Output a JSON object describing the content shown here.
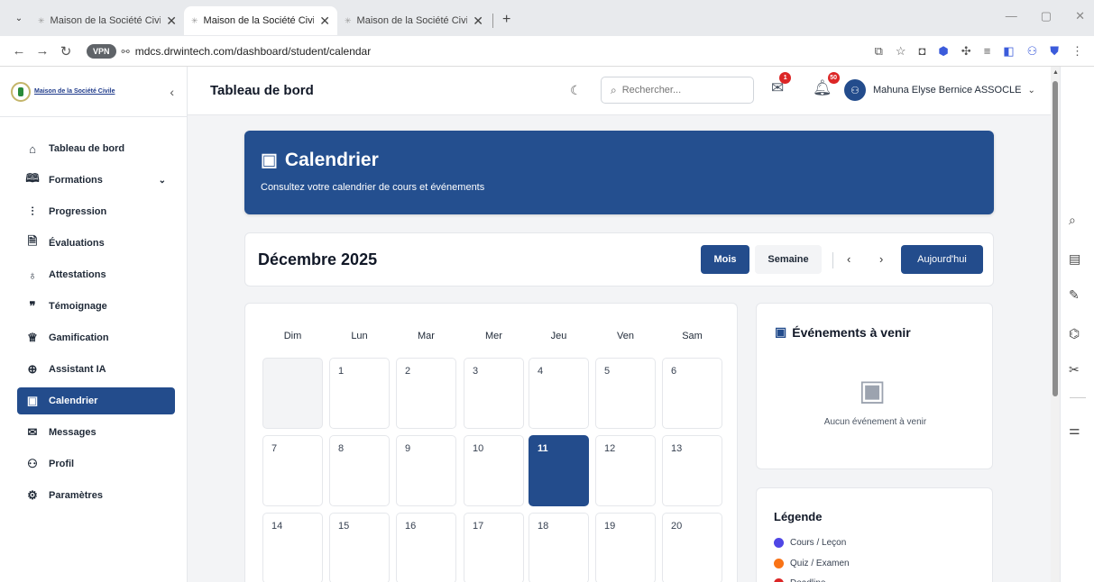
{
  "browser": {
    "tabs": [
      {
        "title": "Maison de la Société Civile - Pla",
        "active": false
      },
      {
        "title": "Maison de la Société Civile - Pla",
        "active": true
      },
      {
        "title": "Maison de la Société Civile - Pla",
        "active": false
      }
    ],
    "vpn_label": "VPN",
    "url": "mdcs.drwintech.com/dashboard/student/calendar"
  },
  "sidebar": {
    "logo_text": "Maison de la Société Civile",
    "items": [
      {
        "label": "Tableau de bord",
        "icon": "home-icon",
        "glyph": "⌂",
        "active": false
      },
      {
        "label": "Formations",
        "icon": "book-icon",
        "glyph": "🕮",
        "active": false,
        "has_chevron": true
      },
      {
        "label": "Progression",
        "icon": "bar-chart-icon",
        "glyph": "⫶",
        "active": false
      },
      {
        "label": "Évaluations",
        "icon": "document-icon",
        "glyph": "🗎",
        "active": false
      },
      {
        "label": "Attestations",
        "icon": "award-icon",
        "glyph": "♁",
        "active": false
      },
      {
        "label": "Témoignage",
        "icon": "quote-icon",
        "glyph": "❞",
        "active": false
      },
      {
        "label": "Gamification",
        "icon": "trophy-icon",
        "glyph": "♕",
        "active": false
      },
      {
        "label": "Assistant IA",
        "icon": "brain-icon",
        "glyph": "⊕",
        "active": false
      },
      {
        "label": "Calendrier",
        "icon": "calendar-icon",
        "glyph": "▣",
        "active": true
      },
      {
        "label": "Messages",
        "icon": "mail-icon",
        "glyph": "✉",
        "active": false
      },
      {
        "label": "Profil",
        "icon": "user-icon",
        "glyph": "⚇",
        "active": false
      },
      {
        "label": "Paramètres",
        "icon": "gear-icon",
        "glyph": "⚙",
        "active": false
      }
    ]
  },
  "header": {
    "title": "Tableau de bord",
    "search_placeholder": "Rechercher...",
    "messages_badge": "1",
    "notifications_badge": "50",
    "user_name": "Mahuna Elyse Bernice ASSOCLE"
  },
  "hero": {
    "title": "Calendrier",
    "subtitle": "Consultez votre calendrier de cours et événements"
  },
  "calendar": {
    "month_label": "Décembre 2025",
    "view_month": "Mois",
    "view_week": "Semaine",
    "today_button": "Aujourd'hui",
    "day_names": [
      "Dim",
      "Lun",
      "Mar",
      "Mer",
      "Jeu",
      "Ven",
      "Sam"
    ],
    "weeks": [
      [
        "",
        "1",
        "2",
        "3",
        "4",
        "5",
        "6"
      ],
      [
        "7",
        "8",
        "9",
        "10",
        "11",
        "12",
        "13"
      ],
      [
        "14",
        "15",
        "16",
        "17",
        "18",
        "19",
        "20"
      ]
    ],
    "today": "11"
  },
  "events": {
    "title": "Événements à venir",
    "empty_text": "Aucun événement à venir"
  },
  "legend": {
    "title": "Légende",
    "items": [
      {
        "label": "Cours / Leçon",
        "color": "#4f46e5"
      },
      {
        "label": "Quiz / Examen",
        "color": "#f97316"
      },
      {
        "label": "Deadline",
        "color": "#dc2626"
      }
    ]
  }
}
